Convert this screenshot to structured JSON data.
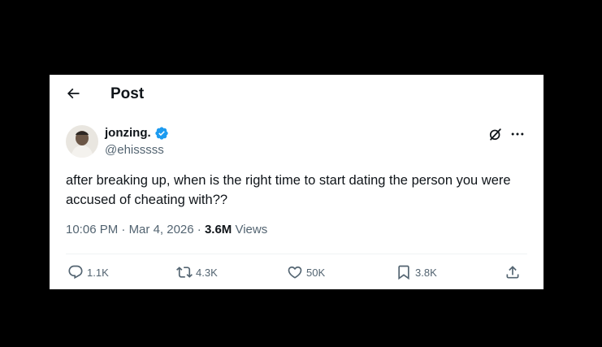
{
  "header": {
    "title": "Post"
  },
  "author": {
    "name": "jonzing.",
    "handle": "@ehisssss"
  },
  "tweet": {
    "text": "after breaking up, when is the right time to start dating the person you were accused of cheating with??"
  },
  "meta": {
    "time": "10:06 PM",
    "separator": "·",
    "date": "Mar 4, 2026",
    "views_count": "3.6M",
    "views_label": "Views"
  },
  "actions": {
    "replies": "1.1K",
    "reposts": "4.3K",
    "likes": "50K",
    "bookmarks": "3.8K"
  },
  "colors": {
    "background": "#000000",
    "card": "#ffffff",
    "text": "#0f1419",
    "secondary": "#536471",
    "verified": "#1d9bf0"
  }
}
